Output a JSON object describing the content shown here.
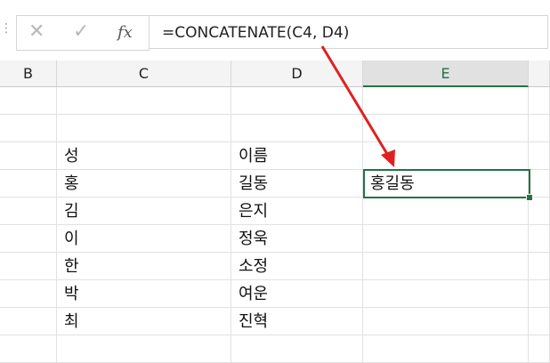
{
  "formula_bar": {
    "dots": "⋮",
    "cancel_icon": "✕",
    "enter_icon": "✓",
    "fx_label": "fx",
    "formula": "=CONCATENATE(C4, D4)"
  },
  "columns": [
    {
      "id": "B",
      "label": "B",
      "active": false
    },
    {
      "id": "C",
      "label": "C",
      "active": false
    },
    {
      "id": "D",
      "label": "D",
      "active": false
    },
    {
      "id": "E",
      "label": "E",
      "active": true
    }
  ],
  "rows": [
    {
      "C": "",
      "D": "",
      "E": ""
    },
    {
      "C": "",
      "D": "",
      "E": ""
    },
    {
      "C": "성",
      "D": "이름",
      "E": ""
    },
    {
      "C": "홍",
      "D": "길동",
      "E": "홍길동"
    },
    {
      "C": "김",
      "D": "은지",
      "E": ""
    },
    {
      "C": "이",
      "D": "정욱",
      "E": ""
    },
    {
      "C": "한",
      "D": "소정",
      "E": ""
    },
    {
      "C": "박",
      "D": "여운",
      "E": ""
    },
    {
      "C": "최",
      "D": "진혁",
      "E": ""
    },
    {
      "C": "",
      "D": "",
      "E": ""
    }
  ],
  "colors": {
    "accent_green": "#217346",
    "arrow_red": "#e02020"
  },
  "icons": [
    "cancel-icon",
    "enter-icon",
    "fx-icon",
    "red-arrow"
  ]
}
